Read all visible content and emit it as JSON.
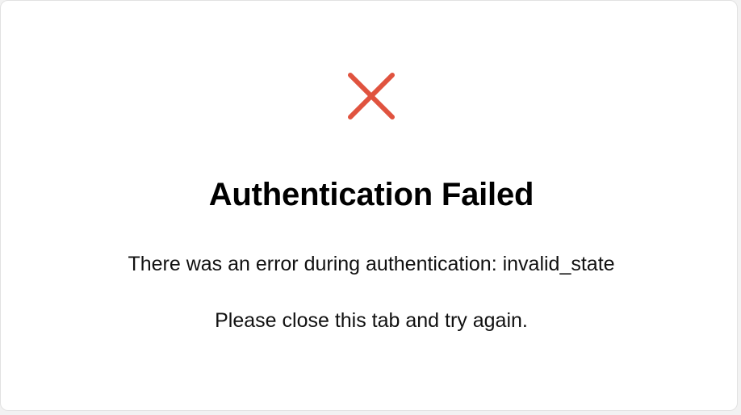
{
  "status": {
    "icon": "close-icon",
    "icon_color": "#e0533f"
  },
  "title": "Authentication Failed",
  "messages": {
    "error": "There was an error during authentication: invalid_state",
    "instruction": "Please close this tab and try again."
  }
}
